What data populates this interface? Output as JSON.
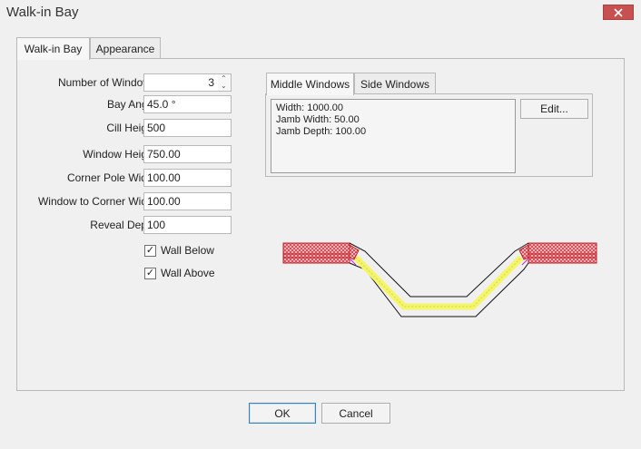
{
  "window": {
    "title": "Walk-in Bay"
  },
  "tabs": [
    "Walk-in Bay",
    "Appearance"
  ],
  "form": {
    "number_of_windows": {
      "label": "Number of Windows",
      "value": "3"
    },
    "bay_angle": {
      "label": "Bay Angle",
      "value": "45.0 °"
    },
    "cill_height": {
      "label": "Cill Height",
      "value": "500"
    },
    "window_height": {
      "label": "Window Height",
      "value": "750.00"
    },
    "corner_pole_width": {
      "label": "Corner Pole Width",
      "value": "100.00"
    },
    "window_to_corner_width": {
      "label": "Window to Corner Width",
      "value": "100.00"
    },
    "reveal_depth": {
      "label": "Reveal Depth",
      "value": "100"
    }
  },
  "checkboxes": {
    "wall_below": {
      "label": "Wall Below",
      "checked": true
    },
    "wall_above": {
      "label": "Wall Above",
      "checked": true
    }
  },
  "windows_panel": {
    "tabs": [
      "Middle Windows",
      "Side Windows"
    ],
    "details": [
      "Width: 1000.00",
      "Jamb Width: 50.00",
      "Jamb Depth: 100.00"
    ],
    "edit_label": "Edit..."
  },
  "buttons": {
    "ok": "OK",
    "cancel": "Cancel"
  },
  "colors": {
    "wall_hatch": "#e0303a",
    "glazing": "#f5f56a",
    "accent_border": "#3c7fb1"
  }
}
